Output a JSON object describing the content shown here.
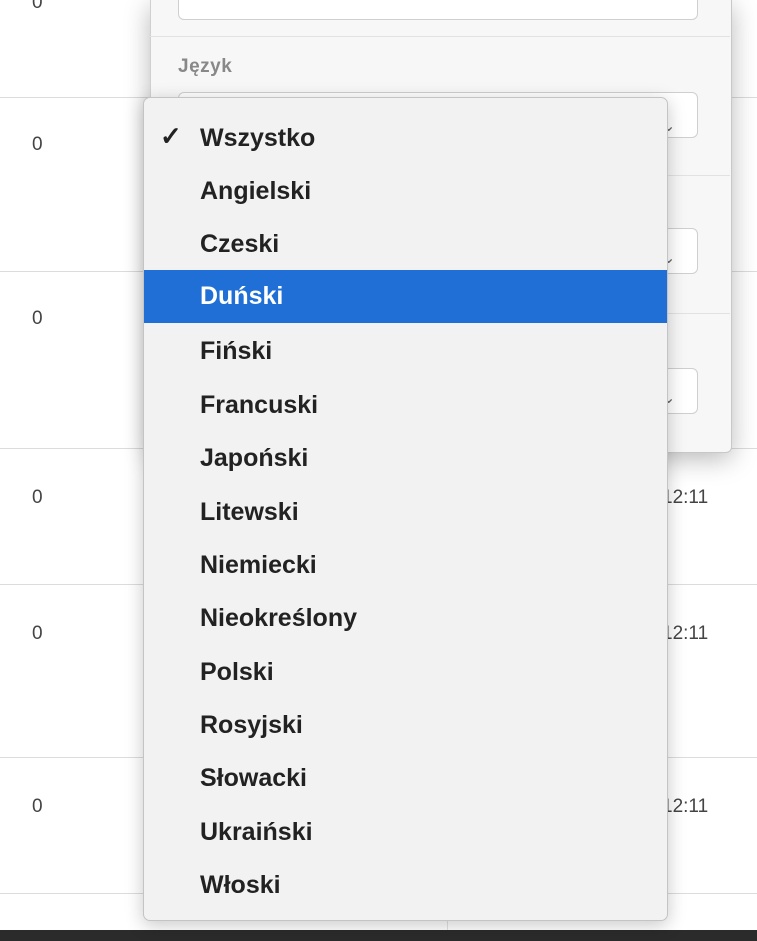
{
  "table": {
    "partial_top_value": "0",
    "rows": [
      {
        "count": "0",
        "time": ""
      },
      {
        "count": "0",
        "time": ""
      },
      {
        "count": "0",
        "time": "12:11"
      },
      {
        "count": "0",
        "time": "12:11"
      },
      {
        "count": "0",
        "time": "12:11"
      }
    ]
  },
  "filter_panel": {
    "language_label": "Język"
  },
  "language_dropdown": {
    "checked_option": "Wszystko",
    "highlighted_option": "Duński",
    "options": [
      "Wszystko",
      "Angielski",
      "Czeski",
      "Duński",
      "Fiński",
      "Francuski",
      "Japoński",
      "Litewski",
      "Niemiecki",
      "Nieokreślony",
      "Polski",
      "Rosyjski",
      "Słowacki",
      "Ukraiński",
      "Włoski"
    ],
    "check_glyph": "✓",
    "highlight_color": "#1f6fd6"
  }
}
